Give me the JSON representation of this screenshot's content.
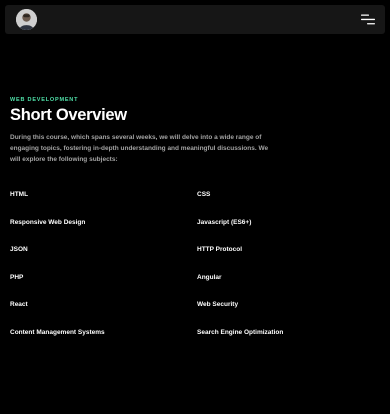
{
  "header": {
    "avatar_icon": "user-avatar",
    "menu_icon": "hamburger-menu-icon"
  },
  "hero": {
    "eyebrow": "WEB DEVELOPMENT",
    "title": "Short Overview",
    "description": "During this course, which spans several weeks, we will delve into a wide range of engaging topics, fostering in-depth understanding and meaningful discussions. We will explore the following subjects:"
  },
  "subjects": [
    "HTML",
    "CSS",
    "Responsive Web Design",
    "Javascript (ES6+)",
    "JSON",
    "HTTP Protocol",
    "PHP",
    "Angular",
    "React",
    "Web Security",
    "Content Management Systems",
    "Search Engine Optimization"
  ],
  "colors": {
    "background": "#000000",
    "navbar": "#161616",
    "accent": "#4fe0a8",
    "text": "#ffffff",
    "muted": "#a3a3a3"
  }
}
